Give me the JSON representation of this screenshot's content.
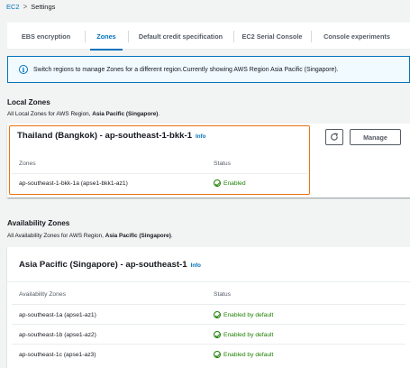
{
  "breadcrumb": {
    "root": "EC2",
    "separator": ">",
    "current": "Settings"
  },
  "tabs": [
    {
      "label": "EBS encryption"
    },
    {
      "label": "Zones"
    },
    {
      "label": "Default credit specification"
    },
    {
      "label": "EC2 Serial Console"
    },
    {
      "label": "Console experiments"
    }
  ],
  "active_tab": "Zones",
  "alert": {
    "text": "Switch regions to manage Zones for a different region.Currently showing AWS Region Asia Pacific (Singapore)."
  },
  "local_zones": {
    "title": "Local Zones",
    "desc_prefix": "All Local Zones for AWS Region, ",
    "desc_region": "Asia Pacific (Singapore)",
    "desc_suffix": ".",
    "group": {
      "title": "Thailand (Bangkok) - ap-southeast-1-bkk-1",
      "info": "Info",
      "refresh_icon": "refresh-icon",
      "manage_label": "Manage",
      "col_zones": "Zones",
      "col_status": "Status",
      "rows": [
        {
          "zone": "ap-southeast-1-bkk-1a (apse1-bkk1-az1)",
          "status": "Enabled"
        }
      ]
    }
  },
  "availability_zones": {
    "title": "Availability Zones",
    "desc_prefix": "All Availability Zones for AWS Region, ",
    "desc_region": "Asia Pacific (Singapore)",
    "desc_suffix": ".",
    "group": {
      "title": "Asia Pacific (Singapore) - ap-southeast-1",
      "info": "Info",
      "col_zones": "Availability Zones",
      "col_status": "Status",
      "rows": [
        {
          "zone": "ap-southeast-1a (apse1-az1)",
          "status": "Enabled by default"
        },
        {
          "zone": "ap-southeast-1b (apse1-az2)",
          "status": "Enabled by default"
        },
        {
          "zone": "ap-southeast-1c (apse1-az3)",
          "status": "Enabled by default"
        }
      ]
    }
  },
  "colors": {
    "accent": "#0073bb",
    "success": "#1d8102",
    "highlight": "#ec7211"
  }
}
